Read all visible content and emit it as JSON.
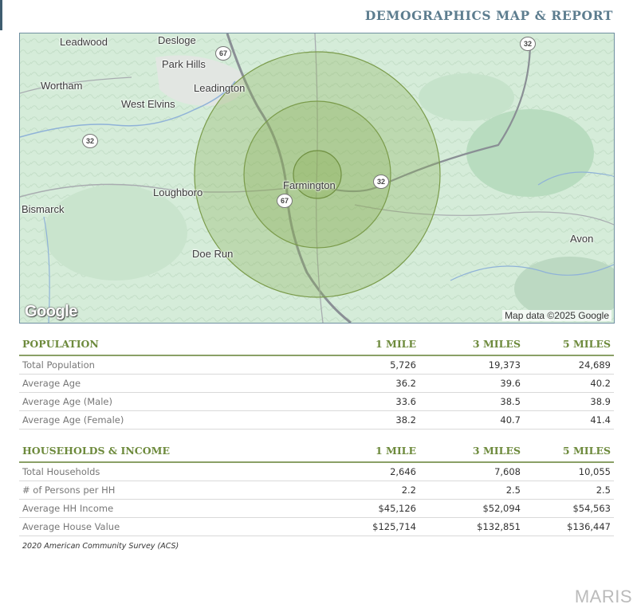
{
  "header": {
    "title": "DEMOGRAPHICS MAP & REPORT"
  },
  "map": {
    "place_labels": [
      "Leadwood",
      "Desloge",
      "Park Hills",
      "Leadington",
      "Wortham",
      "West Elvins",
      "Loughboro",
      "Bismarck",
      "Farmington",
      "Doe Run",
      "Avon"
    ],
    "route_shields": [
      "67",
      "32",
      "32",
      "67",
      "32"
    ],
    "logo_text": "Google",
    "credit": "Map data ©2025 Google",
    "radius_rings_miles": [
      1,
      3,
      5
    ],
    "ring_color": "#8cb05a"
  },
  "population": {
    "headers": [
      "POPULATION",
      "1 MILE",
      "3 MILES",
      "5 MILES"
    ],
    "rows": [
      {
        "label": "Total Population",
        "values": [
          "5,726",
          "19,373",
          "24,689"
        ]
      },
      {
        "label": "Average Age",
        "values": [
          "36.2",
          "39.6",
          "40.2"
        ]
      },
      {
        "label": "Average Age (Male)",
        "values": [
          "33.6",
          "38.5",
          "38.9"
        ]
      },
      {
        "label": "Average Age (Female)",
        "values": [
          "38.2",
          "40.7",
          "41.4"
        ]
      }
    ]
  },
  "households": {
    "headers": [
      "HOUSEHOLDS & INCOME",
      "1 MILE",
      "3 MILES",
      "5 MILES"
    ],
    "rows": [
      {
        "label": "Total Households",
        "values": [
          "2,646",
          "7,608",
          "10,055"
        ]
      },
      {
        "label": "# of Persons per HH",
        "values": [
          "2.2",
          "2.5",
          "2.5"
        ]
      },
      {
        "label": "Average HH Income",
        "values": [
          "$45,126",
          "$52,094",
          "$54,563"
        ]
      },
      {
        "label": "Average House Value",
        "values": [
          "$125,714",
          "$132,851",
          "$136,447"
        ]
      }
    ]
  },
  "source_note": "2020 American Community Survey (ACS)",
  "watermark": "MARIS",
  "colors": {
    "heading_green": "#6d8a3c",
    "title_blue": "#5d7d8f",
    "map_water": "#7aa3d6",
    "map_land": "#d7eddb"
  }
}
